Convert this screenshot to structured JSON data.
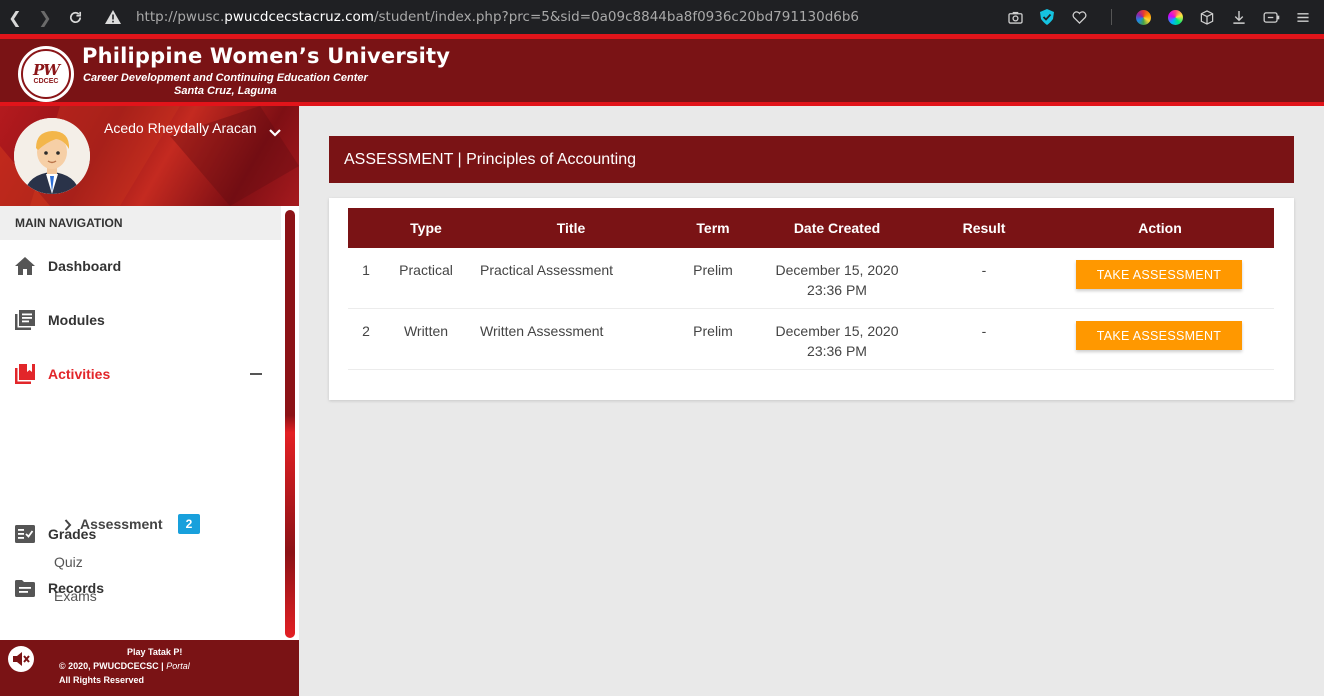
{
  "browser": {
    "url_prefix": "http://pwusc.",
    "url_domain": "pwucdcecstacruz.com",
    "url_path": "/student/index.php?prc=5&sid=0a09c8844ba8f0936c20bd791130d6b6"
  },
  "header": {
    "logo_text": "PW",
    "logo_sub": "CDCEC",
    "university": "Philippine Women’s University",
    "center": "Career Development and Continuing Education Center",
    "location": "Santa Cruz, Laguna"
  },
  "sidebar": {
    "user_name": "Acedo Rheydally Aracan",
    "nav_header": "MAIN NAVIGATION",
    "items": [
      {
        "label": "Dashboard",
        "icon": "home-icon"
      },
      {
        "label": "Modules",
        "icon": "modules-icon"
      },
      {
        "label": "Activities",
        "icon": "activities-icon"
      },
      {
        "label": "Grades",
        "icon": "grades-icon"
      },
      {
        "label": "Records",
        "icon": "records-icon"
      }
    ],
    "sub_items": [
      {
        "label": "Assessment",
        "badge": "2"
      },
      {
        "label": "Quiz"
      },
      {
        "label": "Exams"
      }
    ],
    "footer": {
      "play": "Play Tatak P!",
      "copyright": "© 2020, PWUCDCECSC | ",
      "portal": "Portal",
      "rights": "All Rights Reserved"
    }
  },
  "main": {
    "title": "ASSESSMENT | Principles of Accounting",
    "table": {
      "headers": [
        "",
        "Type",
        "Title",
        "Term",
        "Date Created",
        "Result",
        "Action"
      ],
      "rows": [
        {
          "num": "1",
          "type": "Practical",
          "title": "Practical Assessment",
          "term": "Prelim",
          "date": "December 15, 2020",
          "time": "23:36 PM",
          "result": "-",
          "action": "TAKE ASSESSMENT"
        },
        {
          "num": "2",
          "type": "Written",
          "title": "Written Assessment",
          "term": "Prelim",
          "date": "December 15, 2020",
          "time": "23:36 PM",
          "result": "-",
          "action": "TAKE ASSESSMENT"
        }
      ]
    }
  },
  "colors": {
    "brand": "#7a1315",
    "accent_red": "#e1141a",
    "button": "#ff9800",
    "badge": "#18a0dc"
  }
}
